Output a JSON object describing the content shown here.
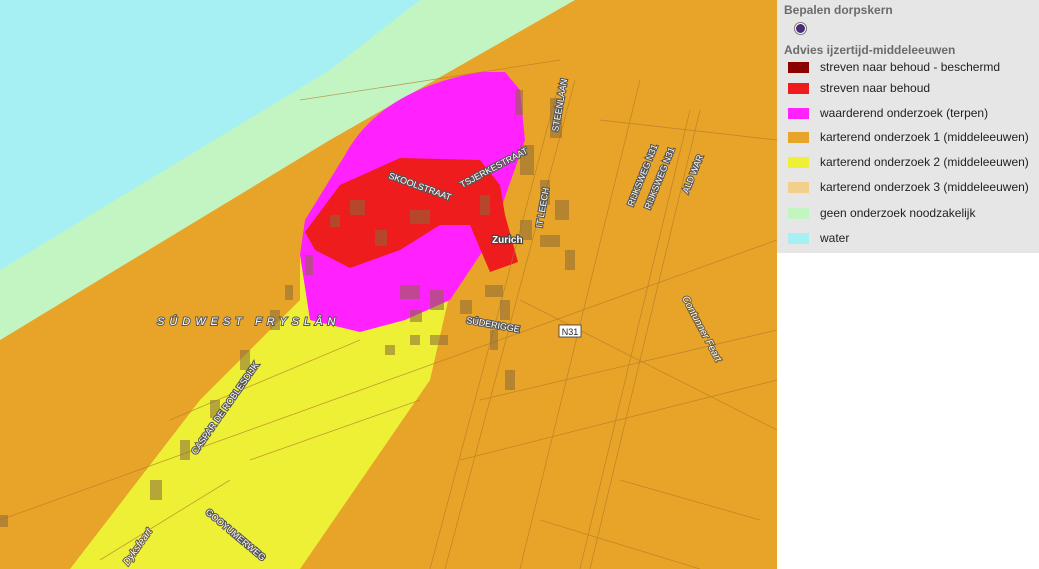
{
  "legend": {
    "title_point": "Bepalen dorpskern",
    "title_advice": "Advies ijzertijd-middeleeuwen",
    "items": [
      {
        "label": "streven naar behoud - beschermd",
        "color": "#8b0000"
      },
      {
        "label": "streven naar behoud",
        "color": "#ee1c1c"
      },
      {
        "label": "waarderend onderzoek (terpen)",
        "color": "#ff22ff"
      },
      {
        "label": "karterend onderzoek 1 (middeleeuwen)",
        "color": "#e8a428"
      },
      {
        "label": "karterend onderzoek 2 (middeleeuwen)",
        "color": "#eef035"
      },
      {
        "label": "karterend onderzoek 3 (middeleeuwen)",
        "color": "#f2cf8a"
      },
      {
        "label": "geen onderzoek noodzakelijk",
        "color": "#c2f5c2"
      },
      {
        "label": "water",
        "color": "#a6f0f4"
      }
    ]
  },
  "map": {
    "labels": {
      "skoolstraat": "SKOOLSTRAAT",
      "tsjerkestraat": "TSJERKESTRAAT",
      "steenlaan": "STEENLAAN",
      "it_leech": "IT LEECH",
      "zurich": "Zurich",
      "rijksweg1": "RIJKSWEG N31",
      "rijksweg2": "RIJKSWEG N31",
      "ald_war": "ALD WAR",
      "sudwest": "SÚDWEST FRYSLÂN",
      "suderigge": "SÚDERIGGE",
      "n31": "N31",
      "caspar": "CASPAR DE ROBLESDIJK",
      "dyksfeart": "Dyksfeart",
      "gooyumerweg": "GOOYUMERWEG",
      "contunner": "Contunner Feart"
    }
  }
}
